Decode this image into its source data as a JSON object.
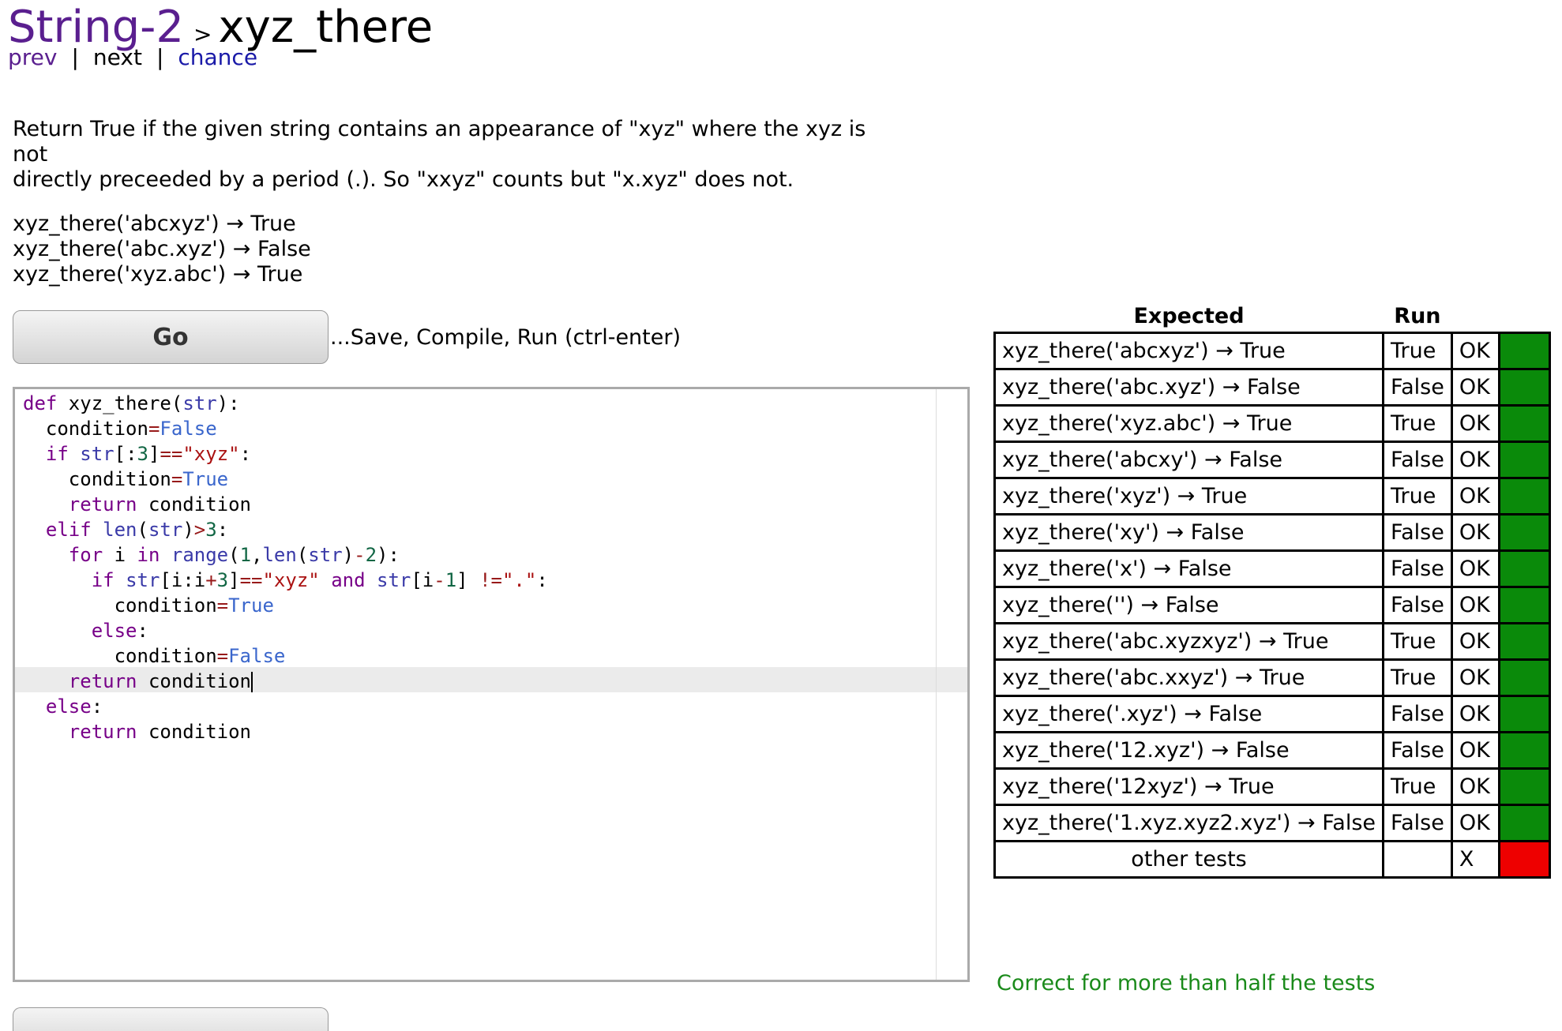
{
  "breadcrumb": {
    "category": "String-2",
    "separator": ">",
    "problem": "xyz_there"
  },
  "nav": {
    "prev": "prev",
    "next": "next",
    "chance": "chance",
    "bar": "|"
  },
  "description": {
    "line1": "Return True if the given string contains an appearance of \"xyz\" where the xyz is not",
    "line2": "directly preceeded by a period (.). So \"xxyz\" counts but \"x.xyz\" does not."
  },
  "examples": [
    "xyz_there('abcxyz') → True",
    "xyz_there('abc.xyz') → False",
    "xyz_there('xyz.abc') → True"
  ],
  "go": {
    "label": "Go",
    "hint": "...Save, Compile, Run (ctrl-enter)"
  },
  "results": {
    "header_expected": "Expected",
    "header_run": "Run",
    "colors": {
      "ok": "#0a8a0a",
      "fail": "#ee0000"
    },
    "rows": [
      {
        "expected": "xyz_there('abcxyz') → True",
        "run": "True",
        "status": "OK",
        "pass": true
      },
      {
        "expected": "xyz_there('abc.xyz') → False",
        "run": "False",
        "status": "OK",
        "pass": true
      },
      {
        "expected": "xyz_there('xyz.abc') → True",
        "run": "True",
        "status": "OK",
        "pass": true
      },
      {
        "expected": "xyz_there('abcxy') → False",
        "run": "False",
        "status": "OK",
        "pass": true
      },
      {
        "expected": "xyz_there('xyz') → True",
        "run": "True",
        "status": "OK",
        "pass": true
      },
      {
        "expected": "xyz_there('xy') → False",
        "run": "False",
        "status": "OK",
        "pass": true
      },
      {
        "expected": "xyz_there('x') → False",
        "run": "False",
        "status": "OK",
        "pass": true
      },
      {
        "expected": "xyz_there('') → False",
        "run": "False",
        "status": "OK",
        "pass": true
      },
      {
        "expected": "xyz_there('abc.xyzxyz') → True",
        "run": "True",
        "status": "OK",
        "pass": true
      },
      {
        "expected": "xyz_there('abc.xxyz') → True",
        "run": "True",
        "status": "OK",
        "pass": true
      },
      {
        "expected": "xyz_there('.xyz') → False",
        "run": "False",
        "status": "OK",
        "pass": true
      },
      {
        "expected": "xyz_there('12.xyz') → False",
        "run": "False",
        "status": "OK",
        "pass": true
      },
      {
        "expected": "xyz_there('12xyz') → True",
        "run": "True",
        "status": "OK",
        "pass": true
      },
      {
        "expected": "xyz_there('1.xyz.xyz2.xyz') → False",
        "run": "False",
        "status": "OK",
        "pass": true
      },
      {
        "expected": "other tests",
        "run": "",
        "status": "X",
        "pass": false
      }
    ],
    "summary": "Correct for more than half the tests"
  }
}
